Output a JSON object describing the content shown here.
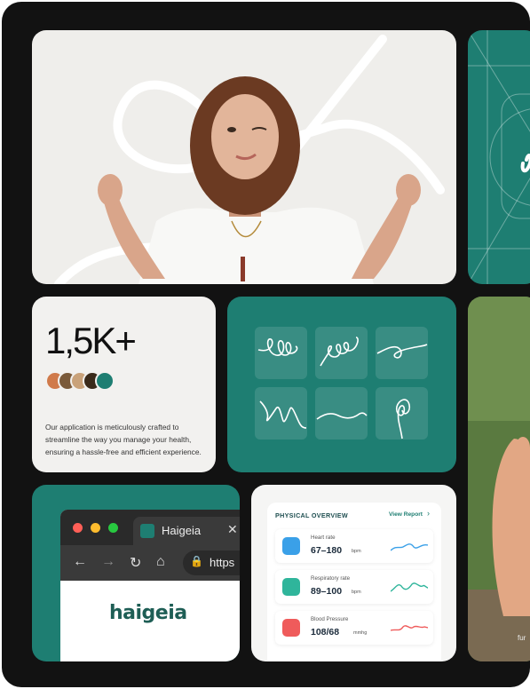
{
  "stats": {
    "count": "1,5K+",
    "description": "Our application is meticulously crafted to streamline the way you manage your health, ensuring a hassle-free and efficient experience."
  },
  "browser": {
    "tab_title": "Haigeia",
    "tab_close": "✕",
    "url_text": "https",
    "logo_text": "haigeia",
    "icons": [
      "back-arrow-icon",
      "forward-arrow-icon",
      "reload-icon",
      "home-icon",
      "lock-icon"
    ]
  },
  "overview": {
    "title": "PHYSICAL OVERVIEW",
    "link": "View Report",
    "metrics": [
      {
        "label": "Heart rate",
        "value": "67–180",
        "unit": "bpm",
        "color": "#3aa0e8"
      },
      {
        "label": "Respiratory rate",
        "value": "89–100",
        "unit": "bpm",
        "color": "#2fb59b"
      },
      {
        "label": "Blood Pressure",
        "value": "108/68",
        "unit": "mmhg",
        "color": "#ef5b5b"
      }
    ]
  },
  "photo_right": {
    "partial_label": "fur"
  },
  "colors": {
    "brand": "#1e7e72",
    "frame": "#121212"
  }
}
